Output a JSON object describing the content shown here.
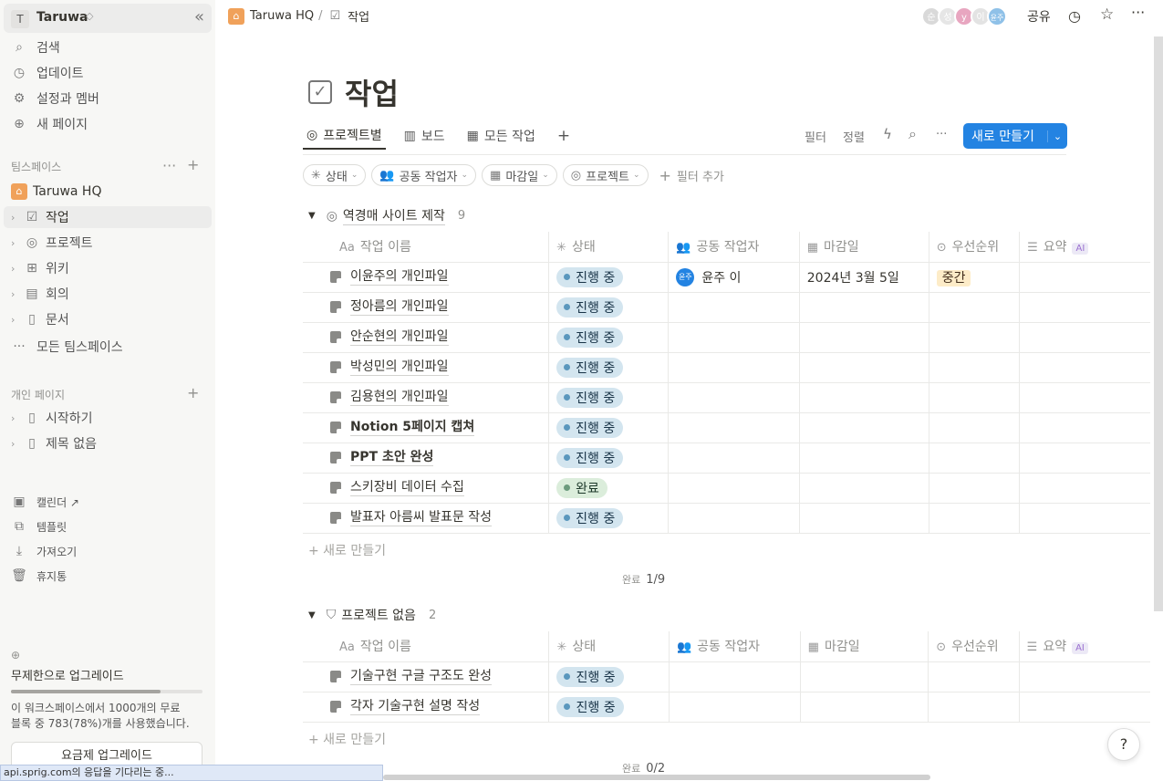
{
  "workspace": {
    "initial": "T",
    "name": "Taruwa",
    "chevron": "◇",
    "collapse": "«"
  },
  "sidebar": {
    "top_items": [
      {
        "icon": "⌕",
        "label": "검색"
      },
      {
        "icon": "◷",
        "label": "업데이트"
      },
      {
        "icon": "⚙",
        "label": "설정과 멤버"
      },
      {
        "icon": "⊕",
        "label": "새 페이지"
      }
    ],
    "teamspace_label": "팀스페이스",
    "teamspace_home": "Taruwa HQ",
    "teamspace_items": [
      {
        "icon": "☑",
        "label": "작업"
      },
      {
        "icon": "◎",
        "label": "프로젝트"
      },
      {
        "icon": "⊞",
        "label": "위키"
      },
      {
        "icon": "▤",
        "label": "회의"
      },
      {
        "icon": "▯",
        "label": "문서"
      }
    ],
    "all_teamspaces": "모든 팀스페이스",
    "personal_label": "개인 페이지",
    "personal_items": [
      {
        "label": "시작하기"
      },
      {
        "label": "제목 없음"
      }
    ],
    "bottom_items": [
      {
        "icon": "▣",
        "label": "캘린더 ↗"
      },
      {
        "icon": "⧉",
        "label": "템플릿"
      },
      {
        "icon": "⤓",
        "label": "가져오기"
      },
      {
        "icon": "🗑",
        "label": "휴지통"
      }
    ],
    "upgrade_title": "무제한으로 업그레이드",
    "upgrade_progress": 0.78,
    "upgrade_desc_1": "이 워크스페이스에서 1000개의 무료",
    "upgrade_desc_2": "블록 중 783(78%)개를 사용했습니다.",
    "upgrade_button": "요금제 업그레이드"
  },
  "status_bar": "api.sprig.com의 응답을 기다리는 중...",
  "topbar": {
    "crumb_home": "Taruwa HQ",
    "crumb_sep": "/",
    "crumb_page": "작업",
    "avatars": [
      {
        "t": "순",
        "c": "#d9d9d9"
      },
      {
        "t": "성",
        "c": "#e6e6e6"
      },
      {
        "t": "y",
        "c": "#e8a6c0"
      },
      {
        "t": "이",
        "c": "#e3e3e3"
      },
      {
        "t": "윤주",
        "c": "#8fc1e8"
      }
    ],
    "share": "공유"
  },
  "page": {
    "title": "작업",
    "tabs": [
      {
        "icon": "◎",
        "label": "프로젝트별"
      },
      {
        "icon": "▥",
        "label": "보드"
      },
      {
        "icon": "▦",
        "label": "모든 작업"
      }
    ],
    "tab_add": "+",
    "actions": {
      "filter": "필터",
      "sort": "정렬",
      "more": "···"
    },
    "new_button": "새로 만들기",
    "filters": [
      {
        "icon": "✳",
        "label": "상태"
      },
      {
        "icon": "👥",
        "label": "공동 작업자"
      },
      {
        "icon": "▦",
        "label": "마감일"
      },
      {
        "icon": "◎",
        "label": "프로젝트"
      }
    ],
    "add_filter": "필터 추가"
  },
  "columns": [
    "작업 이름",
    "상태",
    "공동 작업자",
    "마감일",
    "우선순위",
    "요약"
  ],
  "column_icons": [
    "Aa",
    "✳",
    "👥",
    "▦",
    "⊙",
    "☰"
  ],
  "ai_tag": "AI",
  "groups": [
    {
      "name": "역경매 사이트 제작",
      "count": "9",
      "rows": [
        {
          "name": "이윤주의 개인파일",
          "status": "진행 중",
          "kind": "blue",
          "person": "윤주 이",
          "person_initial": "윤주",
          "due": "2024년 3월 5일",
          "prio": "중간"
        },
        {
          "name": "정아름의 개인파일",
          "status": "진행 중",
          "kind": "blue"
        },
        {
          "name": "안순현의 개인파일",
          "status": "진행 중",
          "kind": "blue"
        },
        {
          "name": "박성민의 개인파일",
          "status": "진행 중",
          "kind": "blue"
        },
        {
          "name": "김용현의 개인파일",
          "status": "진행 중",
          "kind": "blue"
        },
        {
          "name": "Notion 5페이지 캡쳐",
          "status": "진행 중",
          "kind": "blue",
          "bold": true
        },
        {
          "name": "PPT 초안 완성",
          "status": "진행 중",
          "kind": "blue",
          "bold": true
        },
        {
          "name": "스키장비 데이터 수집",
          "status": "완료",
          "kind": "green"
        },
        {
          "name": "발표자 아름씨 발표문 작성",
          "status": "진행 중",
          "kind": "blue"
        }
      ],
      "new_row": "+ 새로 만들기",
      "calc_label": "완료",
      "calc_value": "1/9"
    },
    {
      "name": "프로젝트 없음",
      "count": "2",
      "rows": [
        {
          "name": "기술구현 구글 구조도 완성",
          "status": "진행 중",
          "kind": "blue"
        },
        {
          "name": "각자 기술구현 설명 작성",
          "status": "진행 중",
          "kind": "blue"
        }
      ],
      "new_row": "+ 새로 만들기",
      "calc_label": "완료",
      "calc_value": "0/2"
    }
  ],
  "help": "?"
}
